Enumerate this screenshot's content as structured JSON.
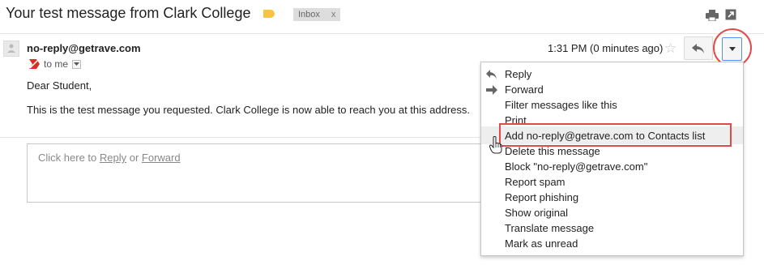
{
  "subject": {
    "title": "Your test message from Clark College",
    "label": "Inbox",
    "label_close": "x"
  },
  "message": {
    "sender": "no-reply@getrave.com",
    "recipient": "to me",
    "time": "1:31 PM (0 minutes ago)",
    "greeting": "Dear Student,",
    "body": "This is the test message you requested.  Clark College is now able to reach you at this address."
  },
  "reply_box": {
    "prefix": "Click here to ",
    "reply_link": "Reply",
    "or": " or ",
    "forward_link": "Forward"
  },
  "menu": {
    "items": [
      "Reply",
      "Forward",
      "Filter messages like this",
      "Print",
      "Add no-reply@getrave.com to Contacts list",
      "Delete this message",
      "Block \"no-reply@getrave.com\"",
      "Report spam",
      "Report phishing",
      "Show original",
      "Translate message",
      "Mark as unread"
    ],
    "highlighted_index": 4
  },
  "icons": {
    "subject_actions": [
      "print-icon",
      "new-window-icon"
    ],
    "message_actions": [
      "star-icon",
      "reply-icon",
      "more-dropdown-icon"
    ]
  },
  "colors": {
    "label_tag": "#f6c344",
    "annotation": "#e04a4a",
    "focus_border": "#4d90fe",
    "highlight_bg": "#eeeeee"
  }
}
